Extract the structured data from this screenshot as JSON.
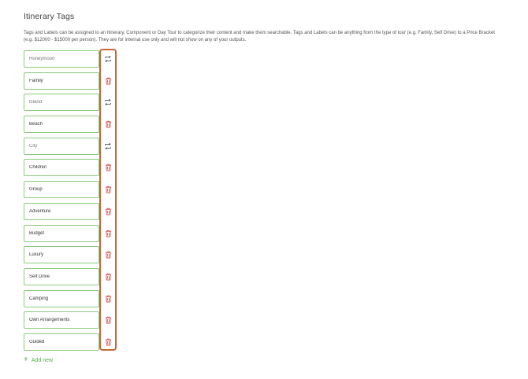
{
  "page": {
    "title": "Itinerary Tags",
    "description": "Tags and Labels can be assigned to an Itinerary, Component or Day Tour to categorize their content and make them searchable. Tags and Labels can be anything from the type of tour (e.g. Family, Self Drive) to a Price Bracket (e.g. $12000 - $15000 per person). They are for internal use only and will not show on any of your outputs."
  },
  "tags": [
    {
      "placeholder": "Honeymoon",
      "value": "",
      "action_icon": "restore-icon"
    },
    {
      "placeholder": "",
      "value": "Family",
      "action_icon": "trash-icon"
    },
    {
      "placeholder": "Island",
      "value": "",
      "action_icon": "restore-icon"
    },
    {
      "placeholder": "",
      "value": "Beach",
      "action_icon": "trash-icon"
    },
    {
      "placeholder": "City",
      "value": "",
      "action_icon": "restore-icon"
    },
    {
      "placeholder": "",
      "value": "Children",
      "action_icon": "trash-icon"
    },
    {
      "placeholder": "",
      "value": "Group",
      "action_icon": "trash-icon"
    },
    {
      "placeholder": "",
      "value": "Adventure",
      "action_icon": "trash-icon"
    },
    {
      "placeholder": "",
      "value": "Budget",
      "action_icon": "trash-icon"
    },
    {
      "placeholder": "",
      "value": "Luxury",
      "action_icon": "trash-icon"
    },
    {
      "placeholder": "",
      "value": "Self Drive",
      "action_icon": "trash-icon"
    },
    {
      "placeholder": "",
      "value": "Camping",
      "action_icon": "trash-icon"
    },
    {
      "placeholder": "",
      "value": "Own Arrangements",
      "action_icon": "trash-icon"
    },
    {
      "placeholder": "",
      "value": "Guided",
      "action_icon": "trash-icon"
    }
  ],
  "add_new": {
    "icon": "plus-icon",
    "label": "Add new"
  },
  "colors": {
    "input_border": "#8cc97d",
    "trash_icon": "#d9534f",
    "restore_icon": "#555555",
    "add_new": "#5aab4a",
    "highlight": "#c4683a"
  }
}
